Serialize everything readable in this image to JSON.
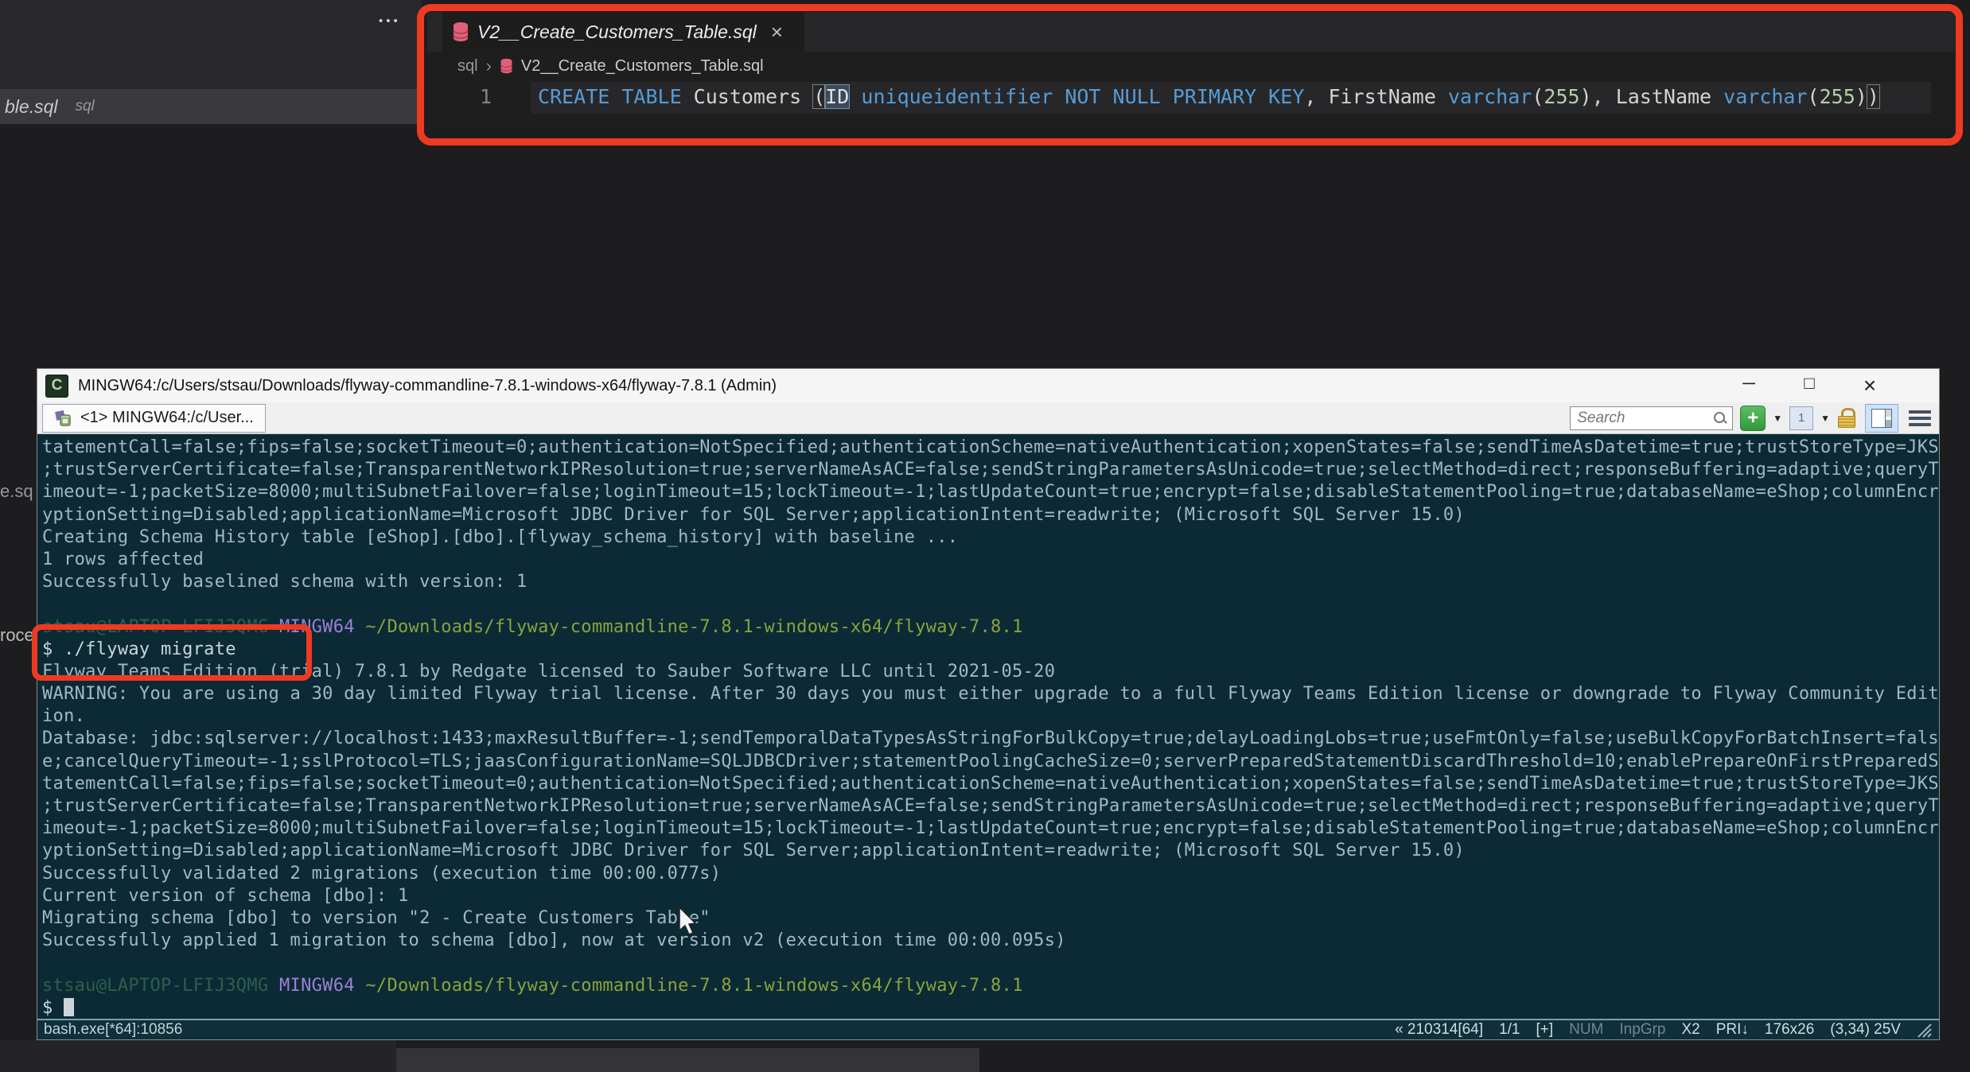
{
  "colors": {
    "annotation_red": "#ee3a21",
    "terminal_bg": "#0b2a36",
    "editor_bg": "#1e1e1e",
    "keyword_blue": "#569cd6",
    "number_green": "#b5cea8",
    "prompt_user_green": "#2f5f49",
    "prompt_msys_purple": "#9b7fd4",
    "prompt_path_olive": "#8ba33a",
    "new_console_green": "#3fae4a",
    "db_icon_pink": "#e0607a"
  },
  "editor": {
    "overflow_dots": "•••",
    "background_tab_fragment": {
      "file": "ble.sql",
      "lang": "sql"
    },
    "left_fragments": {
      "fragment1": "e.sq",
      "fragment2": "roce"
    },
    "tab": {
      "title": "V2__Create_Customers_Table.sql",
      "close": "×"
    },
    "breadcrumb": {
      "folder": "sql",
      "separator": "›",
      "file": "V2__Create_Customers_Table.sql"
    },
    "code": {
      "line_number": "1",
      "tokens": [
        {
          "t": "CREATE TABLE ",
          "c": "k"
        },
        {
          "t": "Customers ",
          "c": "p"
        },
        {
          "t": "(",
          "c": "brkt"
        },
        {
          "t": "ID",
          "c": "sel"
        },
        {
          "t": " ",
          "c": "p"
        },
        {
          "t": "uniqueidentifier",
          "c": "k"
        },
        {
          "t": " ",
          "c": "p"
        },
        {
          "t": "NOT NULL PRIMARY KEY",
          "c": "k"
        },
        {
          "t": ", FirstName ",
          "c": "p"
        },
        {
          "t": "varchar",
          "c": "k"
        },
        {
          "t": "(",
          "c": "p"
        },
        {
          "t": "255",
          "c": "n"
        },
        {
          "t": "), LastName ",
          "c": "p"
        },
        {
          "t": "varchar",
          "c": "k"
        },
        {
          "t": "(",
          "c": "p"
        },
        {
          "t": "255",
          "c": "n"
        },
        {
          "t": ")",
          "c": "p"
        },
        {
          "t": ")",
          "c": "brkt"
        }
      ]
    }
  },
  "terminal": {
    "title": "MINGW64:/c/Users/stsau/Downloads/flyway-commandline-7.8.1-windows-x64/flyway-7.8.1 (Admin)",
    "window_controls": {
      "minimize": "─",
      "maximize": "□",
      "close": "×"
    },
    "tab_label": "<1> MINGW64:/c/User...",
    "search": {
      "placeholder": "Search"
    },
    "toolbar": {
      "new_console": "+",
      "new_console_dropdown": "▼",
      "window_number": "1",
      "window_dropdown": "▼"
    },
    "lines": [
      [
        {
          "t": "tatementCall=false;fips=false;socketTimeout=0;authentication=NotSpecified;authenticationScheme=nativeAuthentication;xopenStates=false;sendTimeAsDatetime=true;trustStoreType=JKS"
        }
      ],
      [
        {
          "t": ";trustServerCertificate=false;TransparentNetworkIPResolution=true;serverNameAsACE=false;sendStringParametersAsUnicode=true;selectMethod=direct;responseBuffering=adaptive;queryT"
        }
      ],
      [
        {
          "t": "imeout=-1;packetSize=8000;multiSubnetFailover=false;loginTimeout=15;lockTimeout=-1;lastUpdateCount=true;encrypt=false;disableStatementPooling=true;databaseName=eShop;columnEncr"
        }
      ],
      [
        {
          "t": "yptionSetting=Disabled;applicationName=Microsoft JDBC Driver for SQL Server;applicationIntent=readwrite; (Microsoft SQL Server 15.0)"
        }
      ],
      [
        {
          "t": "Creating Schema History table [eShop].[dbo].[flyway_schema_history] with baseline ..."
        }
      ],
      [
        {
          "t": "1 rows affected"
        }
      ],
      [
        {
          "t": "Successfully baselined schema with version: 1"
        }
      ],
      [],
      [
        {
          "t": "stsau@LAPTOP-LFIJ3QMG ",
          "c": "user"
        },
        {
          "t": "MINGW64 ",
          "c": "sys"
        },
        {
          "t": "~/Downloads/flyway-commandline-7.8.1-windows-x64/flyway-7.8.1",
          "c": "path"
        }
      ],
      [
        {
          "t": "$ ./flyway migrate",
          "c": "cmd"
        }
      ],
      [
        {
          "t": "Flyway Teams Edition (trial) 7.8.1 by Redgate licensed to Sauber Software LLC until 2021-05-20"
        }
      ],
      [
        {
          "t": "WARNING: You are using a 30 day limited Flyway trial license. After 30 days you must either upgrade to a full Flyway Teams Edition license or downgrade to Flyway Community Edit"
        }
      ],
      [
        {
          "t": "ion."
        }
      ],
      [
        {
          "t": "Database: jdbc:sqlserver://localhost:1433;maxResultBuffer=-1;sendTemporalDataTypesAsStringForBulkCopy=true;delayLoadingLobs=true;useFmtOnly=false;useBulkCopyForBatchInsert=fals"
        }
      ],
      [
        {
          "t": "e;cancelQueryTimeout=-1;sslProtocol=TLS;jaasConfigurationName=SQLJDBCDriver;statementPoolingCacheSize=0;serverPreparedStatementDiscardThreshold=10;enablePrepareOnFirstPreparedS"
        }
      ],
      [
        {
          "t": "tatementCall=false;fips=false;socketTimeout=0;authentication=NotSpecified;authenticationScheme=nativeAuthentication;xopenStates=false;sendTimeAsDatetime=true;trustStoreType=JKS"
        }
      ],
      [
        {
          "t": ";trustServerCertificate=false;TransparentNetworkIPResolution=true;serverNameAsACE=false;sendStringParametersAsUnicode=true;selectMethod=direct;responseBuffering=adaptive;queryT"
        }
      ],
      [
        {
          "t": "imeout=-1;packetSize=8000;multiSubnetFailover=false;loginTimeout=15;lockTimeout=-1;lastUpdateCount=true;encrypt=false;disableStatementPooling=true;databaseName=eShop;columnEncr"
        }
      ],
      [
        {
          "t": "yptionSetting=Disabled;applicationName=Microsoft JDBC Driver for SQL Server;applicationIntent=readwrite; (Microsoft SQL Server 15.0)"
        }
      ],
      [
        {
          "t": "Successfully validated 2 migrations (execution time 00:00.077s)"
        }
      ],
      [
        {
          "t": "Current version of schema [dbo]: 1"
        }
      ],
      [
        {
          "t": "Migrating schema [dbo] to version \"2 - Create Customers Table\""
        }
      ],
      [
        {
          "t": "Successfully applied 1 migration to schema [dbo], now at version v2 (execution time 00:00.095s)"
        }
      ],
      [],
      [
        {
          "t": "stsau@LAPTOP-LFIJ3QMG ",
          "c": "user"
        },
        {
          "t": "MINGW64 ",
          "c": "sys"
        },
        {
          "t": "~/Downloads/flyway-commandline-7.8.1-windows-x64/flyway-7.8.1",
          "c": "path"
        }
      ],
      [
        {
          "t": "$ ",
          "c": "cmd"
        },
        {
          "t": "",
          "c": "cursor"
        }
      ]
    ],
    "status_bar": {
      "process": "bash.exe[*64]:10856",
      "items": [
        {
          "t": "« 210314[64]"
        },
        {
          "t": "1/1"
        },
        {
          "t": "[+]"
        },
        {
          "t": "NUM",
          "dim": true
        },
        {
          "t": "InpGrp",
          "dim": true
        },
        {
          "t": "X2"
        },
        {
          "t": "PRI↓"
        },
        {
          "t": "176x26"
        },
        {
          "t": "(3,34) 25V"
        }
      ]
    }
  }
}
